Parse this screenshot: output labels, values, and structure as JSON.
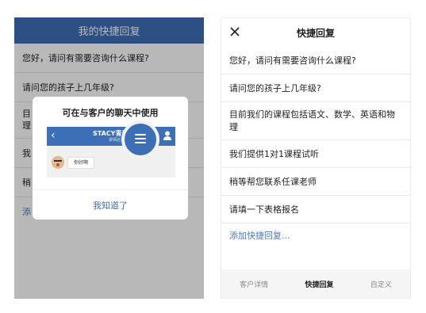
{
  "left_panel": {
    "title": "我的快捷回复",
    "rows": [
      "您好，请问有需要咨询什么课程?",
      "请问您的孩子上几年级?",
      "目",
      "我",
      "稍"
    ],
    "row3_line2": "理",
    "add_text": "添",
    "tooltip": {
      "title": "可在与客户的聊天中使用",
      "mock_name": "STACY青青",
      "mock_sub": "讲师店",
      "mock_bubble": "你好啊",
      "confirm": "我知道了"
    }
  },
  "right_panel": {
    "title": "快捷回复",
    "rows": [
      "您好，请问有需要咨询什么课程?",
      "请问您的孩子上几年级?",
      "目前我们的课程包括语文、数学、英语和物理",
      "我们提供1对1课程试听",
      "稍等帮您联系任课老师",
      "请填一下表格报名"
    ],
    "add_text": "添加快捷回复...",
    "tabs": [
      "客户详情",
      "快捷回复",
      "自定义"
    ]
  },
  "colors": {
    "accent": "#3d6fb6",
    "link": "#4a78c0"
  }
}
